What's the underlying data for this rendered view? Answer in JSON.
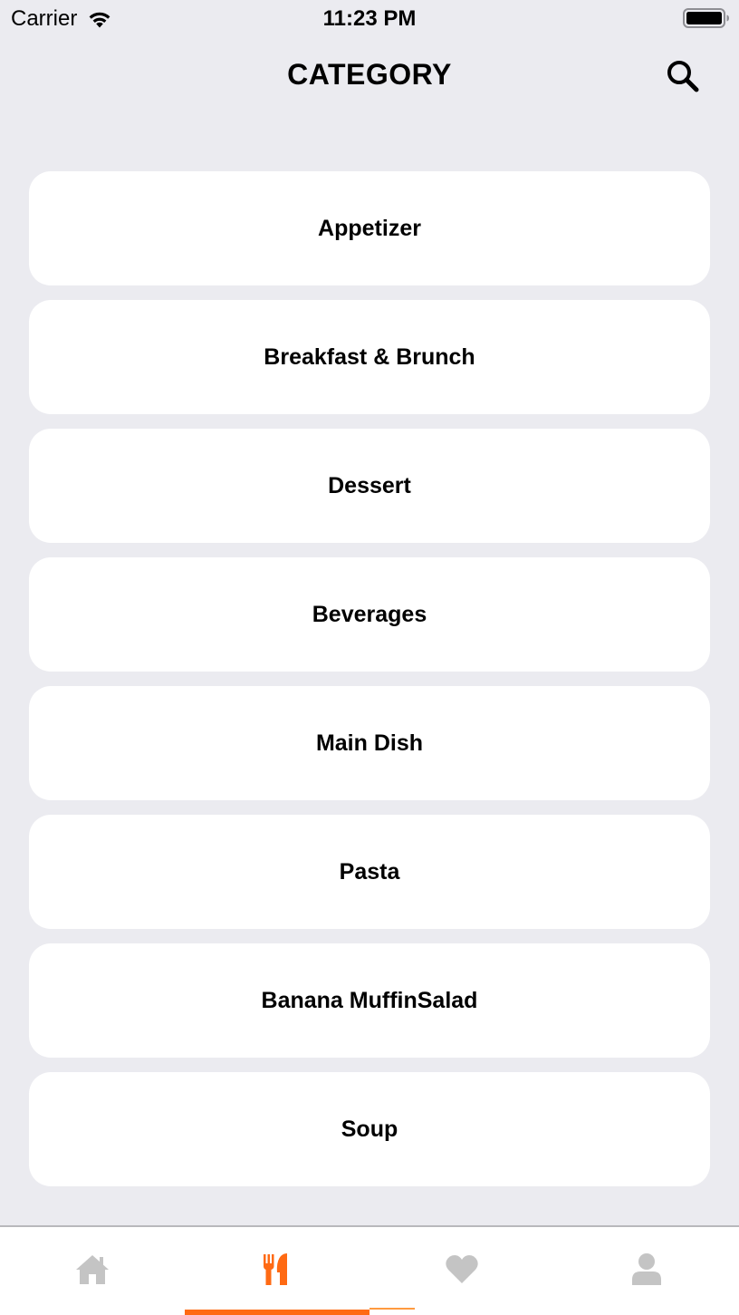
{
  "status_bar": {
    "carrier": "Carrier",
    "time": "11:23 PM"
  },
  "header": {
    "title": "CATEGORY",
    "search_icon": "search-icon"
  },
  "categories": [
    {
      "label": "Appetizer"
    },
    {
      "label": "Breakfast & Brunch"
    },
    {
      "label": "Dessert"
    },
    {
      "label": "Beverages"
    },
    {
      "label": "Main Dish"
    },
    {
      "label": "Pasta"
    },
    {
      "label": "Banana MuffinSalad"
    },
    {
      "label": "Soup"
    }
  ],
  "tab_bar": {
    "tabs": [
      {
        "icon": "home-icon",
        "active": false
      },
      {
        "icon": "utensils-icon",
        "active": true
      },
      {
        "icon": "heart-icon",
        "active": false
      },
      {
        "icon": "user-icon",
        "active": false
      }
    ]
  },
  "colors": {
    "background": "#ebebf0",
    "card": "#ffffff",
    "accent": "#ff6a13",
    "inactive_icon": "#c4c4c4",
    "text": "#000000"
  }
}
